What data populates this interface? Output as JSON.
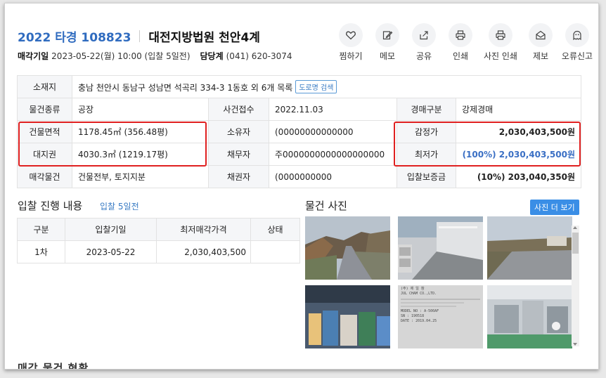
{
  "header": {
    "case_no": "2022 타경 108823",
    "court": "대전지방법원 천안4계",
    "sale_date_label": "매각기일",
    "sale_date_value": "2023-05-22(월) 10:00 (입찰 5일전)",
    "dept_label": "담당계",
    "dept_value": "(041) 620-3074"
  },
  "actions": [
    {
      "label": "찜하기",
      "icon": "heart-icon"
    },
    {
      "label": "메모",
      "icon": "pencil-icon"
    },
    {
      "label": "공유",
      "icon": "share-icon"
    },
    {
      "label": "인쇄",
      "icon": "printer-icon"
    },
    {
      "label": "사진 인쇄",
      "icon": "printer-icon"
    },
    {
      "label": "제보",
      "icon": "envelope-icon"
    },
    {
      "label": "오류신고",
      "icon": "ghost-icon"
    }
  ],
  "info": {
    "address_label": "소재지",
    "address_value": "충남 천안시 동남구 성남면 석곡리 334-3 1동호 외 6개 목록",
    "road_btn": "도로명 검색",
    "type_label": "물건종류",
    "type_value": "공장",
    "filed_label": "사건접수",
    "filed_value": "2022.11.03",
    "auction_type_label": "경매구분",
    "auction_type_value": "강제경매",
    "bldg_area_label": "건물면적",
    "bldg_area_value": "1178.45㎡ (356.48평)",
    "owner_label": "소유자",
    "owner_value": "(00000000000000",
    "appraisal_label": "감정가",
    "appraisal_value": "2,030,403,500원",
    "land_label": "대지권",
    "land_value": "4030.3㎡ (1219.17평)",
    "debtor_label": "채무자",
    "debtor_value": "주0000000000000000000",
    "min_price_label": "최저가",
    "min_price_value": "(100%) 2,030,403,500원",
    "sale_obj_label": "매각물건",
    "sale_obj_value": "건물전부, 토지지분",
    "creditor_label": "채권자",
    "creditor_value": "(0000000000",
    "deposit_label": "입찰보증금",
    "deposit_value": "(10%) 203,040,350원"
  },
  "bid_section": {
    "title": "입찰 진행 내용",
    "subtitle": "입찰 5일전",
    "columns": [
      "구분",
      "입찰기일",
      "최저매각가격",
      "상태"
    ],
    "rows": [
      {
        "round": "1차",
        "date": "2023-05-22",
        "price": "2,030,403,500",
        "status": ""
      }
    ]
  },
  "photo_section": {
    "title": "물건 사진",
    "more_btn": "사진 더 보기",
    "plate_text": "(주) 제 일 참\nJUL CHAM CO.,LTD.\nMODEL NO : A-500AF\nSN : 190518\nDATE : 2019.04.25",
    "plate_lines": [
      "(주) 제 일 참",
      "JUL CHAM CO.,LTD.",
      "MODEL NO : A-500AF",
      "SN : 190518",
      "DATE : 2019.04.25"
    ]
  },
  "cut_off_text": "매각 물건 현황",
  "colors": {
    "accent": "#2f6bbf",
    "highlight_border": "#e02020",
    "button": "#3a8ee6"
  }
}
